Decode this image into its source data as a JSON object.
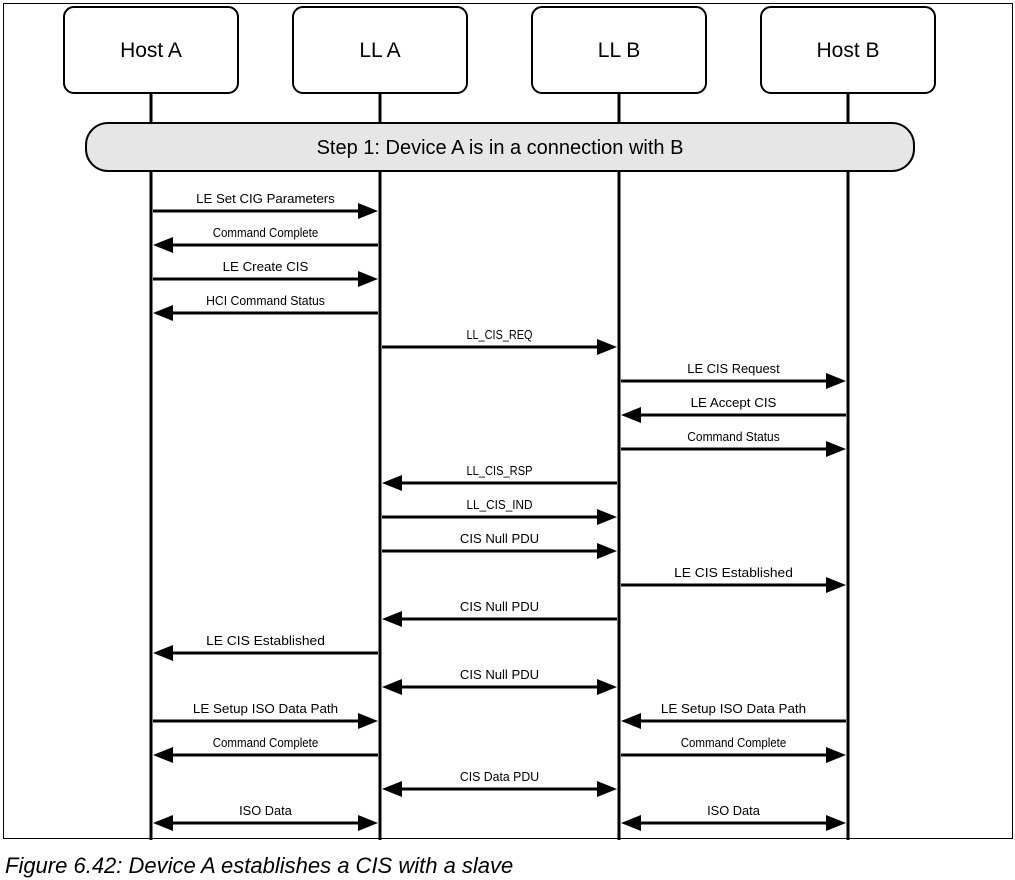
{
  "figure": {
    "caption": "Figure 6.42:  Device A establishes a CIS with a slave",
    "colors": {
      "line": "#000000",
      "box_fill": "#ffffff",
      "step_fill": "#e6e6e6",
      "text": "#000000"
    }
  },
  "participants": [
    {
      "id": "host_a",
      "label": "Host A"
    },
    {
      "id": "ll_a",
      "label": "LL A"
    },
    {
      "id": "ll_b",
      "label": "LL B"
    },
    {
      "id": "host_b",
      "label": "Host B"
    }
  ],
  "step": {
    "label": "Step 1: Device A is in a connection with B"
  },
  "messages": [
    {
      "label": "LE Set CIG Parameters",
      "from": "host_a",
      "to": "ll_a",
      "bidirectional": false
    },
    {
      "label": "Command Complete",
      "from": "ll_a",
      "to": "host_a",
      "bidirectional": false
    },
    {
      "label": "LE Create CIS",
      "from": "host_a",
      "to": "ll_a",
      "bidirectional": false
    },
    {
      "label": "HCI Command Status",
      "from": "ll_a",
      "to": "host_a",
      "bidirectional": false
    },
    {
      "label": "LL_CIS_REQ",
      "from": "ll_a",
      "to": "ll_b",
      "bidirectional": false
    },
    {
      "label": "LE CIS Request",
      "from": "ll_b",
      "to": "host_b",
      "bidirectional": false
    },
    {
      "label": "LE Accept CIS",
      "from": "host_b",
      "to": "ll_b",
      "bidirectional": false
    },
    {
      "label": "Command Status",
      "from": "ll_b",
      "to": "host_b",
      "bidirectional": false
    },
    {
      "label": "LL_CIS_RSP",
      "from": "ll_b",
      "to": "ll_a",
      "bidirectional": false
    },
    {
      "label": "LL_CIS_IND",
      "from": "ll_a",
      "to": "ll_b",
      "bidirectional": false
    },
    {
      "label": "CIS Null PDU",
      "from": "ll_a",
      "to": "ll_b",
      "bidirectional": false
    },
    {
      "label": "LE CIS Established",
      "from": "ll_b",
      "to": "host_b",
      "bidirectional": false
    },
    {
      "label": "CIS Null PDU",
      "from": "ll_b",
      "to": "ll_a",
      "bidirectional": false
    },
    {
      "label": "LE CIS Established",
      "from": "ll_a",
      "to": "host_a",
      "bidirectional": false
    },
    {
      "label": "CIS Null PDU",
      "from": "ll_a",
      "to": "ll_b",
      "bidirectional": true
    },
    {
      "label": "LE Setup ISO Data Path",
      "from": "host_a",
      "to": "ll_a",
      "bidirectional": false,
      "same_row_as_next": true
    },
    {
      "label": "LE Setup ISO Data Path",
      "from": "host_b",
      "to": "ll_b",
      "bidirectional": false
    },
    {
      "label": "Command Complete",
      "from": "ll_a",
      "to": "host_a",
      "bidirectional": false,
      "same_row_as_next": true
    },
    {
      "label": "Command Complete",
      "from": "ll_b",
      "to": "host_b",
      "bidirectional": false
    },
    {
      "label": "CIS Data PDU",
      "from": "ll_a",
      "to": "ll_b",
      "bidirectional": true
    },
    {
      "label": "ISO Data",
      "from": "host_a",
      "to": "ll_a",
      "bidirectional": true,
      "same_row_as_next": true
    },
    {
      "label": "ISO Data",
      "from": "ll_b",
      "to": "host_b",
      "bidirectional": true
    }
  ]
}
